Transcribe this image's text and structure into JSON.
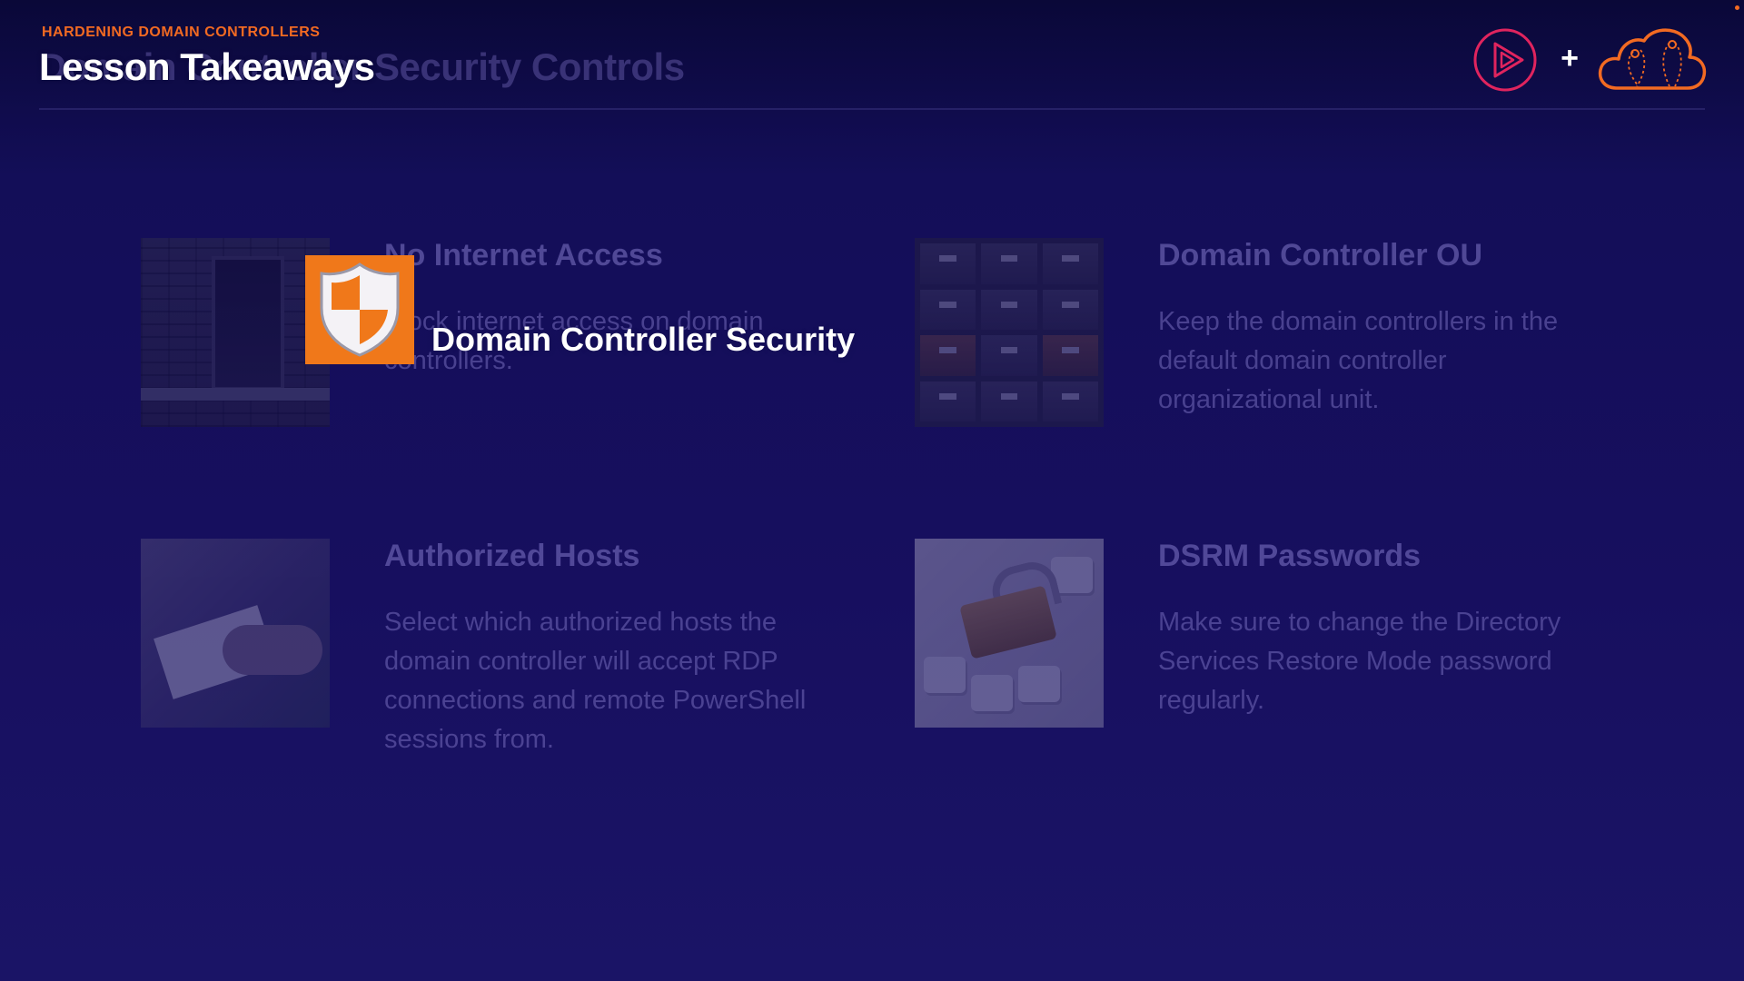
{
  "header": {
    "kicker": "HARDENING DOMAIN CONTROLLERS",
    "title": "Lesson Takeaways",
    "title_behind": "Domain Controller Security Controls"
  },
  "brand": {
    "play_icon": "play-circle-icon",
    "plus": "+",
    "cloud_icon": "cloud-logo-icon"
  },
  "cards": [
    {
      "title": "No Internet Access",
      "text": "Block internet access on domain controllers.",
      "image": "brick-door-photo"
    },
    {
      "title": "Domain Controller OU",
      "text": "Keep the domain controllers in the default domain controller organizational unit.",
      "image": "file-drawers-photo"
    },
    {
      "title": "Authorized Hosts",
      "text": "Select which authorized hosts the domain controller will accept RDP connections and remote PowerShell sessions from.",
      "image": "hands-paper-photo"
    },
    {
      "title": "DSRM Passwords",
      "text": "Make sure to change the Directory Services Restore Mode password regularly.",
      "image": "padlock-keyboard-photo"
    }
  ],
  "overlay": {
    "icon": "shield-icon",
    "label": "Domain Controller Security"
  },
  "colors": {
    "accent": "#f26a22",
    "background": "#170f5f",
    "brand_pink": "#e0245e"
  }
}
